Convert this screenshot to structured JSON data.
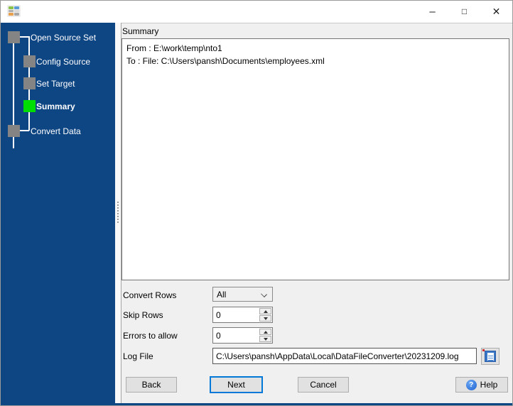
{
  "window": {
    "controls": {
      "minimize": "–",
      "maximize": "□",
      "close": "✕"
    }
  },
  "sidebar": {
    "steps": [
      {
        "label": "Open Source Set",
        "active": false
      },
      {
        "label": "Config Source",
        "active": false
      },
      {
        "label": "Set Target",
        "active": false
      },
      {
        "label": "Summary",
        "active": true
      },
      {
        "label": "Convert Data",
        "active": false
      }
    ]
  },
  "summary": {
    "title": "Summary",
    "lines": [
      "From : E:\\work\\temp\\nto1",
      "To : File: C:\\Users\\pansh\\Documents\\employees.xml"
    ]
  },
  "form": {
    "convert_rows": {
      "label": "Convert Rows",
      "value": "All"
    },
    "skip_rows": {
      "label": "Skip Rows",
      "value": "0"
    },
    "errors_to_allow": {
      "label": "Errors to allow",
      "value": "0"
    },
    "log_file": {
      "label": "Log File",
      "value": "C:\\Users\\pansh\\AppData\\Local\\DataFileConverter\\20231209.log"
    }
  },
  "buttons": {
    "back": "Back",
    "next": "Next",
    "cancel": "Cancel",
    "help": "Help"
  },
  "icons": {
    "help_glyph": "?"
  },
  "colors": {
    "sidebar": "#0e4583",
    "active_step": "#00dd00",
    "inactive_step": "#848484",
    "focus_border": "#0078d7",
    "button_face": "#e1e1e1"
  }
}
